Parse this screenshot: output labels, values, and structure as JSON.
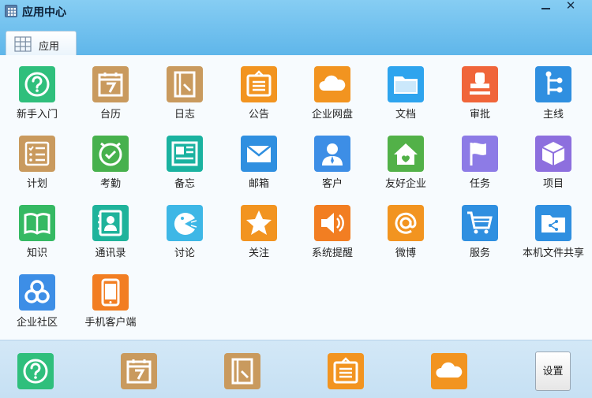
{
  "window": {
    "title": "应用中心",
    "minimize_glyph": "—",
    "close_glyph": "✕"
  },
  "tab": {
    "label": "应用"
  },
  "apps": [
    {
      "label": "新手入门",
      "icon": "help-icon",
      "color": "#2fbf7c"
    },
    {
      "label": "台历",
      "icon": "calendar-icon",
      "color": "#c99a5e"
    },
    {
      "label": "日志",
      "icon": "journal-icon",
      "color": "#c99a5e"
    },
    {
      "label": "公告",
      "icon": "announcement-icon",
      "color": "#f29420"
    },
    {
      "label": "企业网盘",
      "icon": "cloud-drive-icon",
      "color": "#f29420"
    },
    {
      "label": "文档",
      "icon": "folder-icon",
      "color": "#2ea4ee"
    },
    {
      "label": "审批",
      "icon": "stamp-icon",
      "color": "#f0653a"
    },
    {
      "label": "主线",
      "icon": "branch-icon",
      "color": "#2f8fe0"
    },
    {
      "label": "计划",
      "icon": "checklist-icon",
      "color": "#c99a5e"
    },
    {
      "label": "考勤",
      "icon": "clock-icon",
      "color": "#47b14d"
    },
    {
      "label": "备忘",
      "icon": "memo-icon",
      "color": "#1ab2a0"
    },
    {
      "label": "邮箱",
      "icon": "mail-icon",
      "color": "#2f8fe0"
    },
    {
      "label": "客户",
      "icon": "customer-icon",
      "color": "#3d8ee6"
    },
    {
      "label": "友好企业",
      "icon": "friendly-company-icon",
      "color": "#52b148"
    },
    {
      "label": "任务",
      "icon": "flag-icon",
      "color": "#8d7be6"
    },
    {
      "label": "项目",
      "icon": "cube-icon",
      "color": "#8d6fde"
    },
    {
      "label": "知识",
      "icon": "book-icon",
      "color": "#35b963"
    },
    {
      "label": "通讯录",
      "icon": "contacts-icon",
      "color": "#1fb39b"
    },
    {
      "label": "讨论",
      "icon": "discussion-icon",
      "color": "#3eb7e6"
    },
    {
      "label": "关注",
      "icon": "star-icon",
      "color": "#f29420"
    },
    {
      "label": "系统提醒",
      "icon": "speaker-icon",
      "color": "#f27e22"
    },
    {
      "label": "微博",
      "icon": "at-icon",
      "color": "#f29420"
    },
    {
      "label": "服务",
      "icon": "cart-icon",
      "color": "#2f8fe0"
    },
    {
      "label": "本机文件共享",
      "icon": "file-share-icon",
      "color": "#2f8fe0"
    },
    {
      "label": "企业社区",
      "icon": "community-icon",
      "color": "#3d8ee6"
    },
    {
      "label": "手机客户端",
      "icon": "mobile-icon",
      "color": "#f27e22"
    }
  ],
  "dock": [
    {
      "icon": "help-icon",
      "color": "#2fbf7c"
    },
    {
      "icon": "calendar-icon",
      "color": "#c99a5e"
    },
    {
      "icon": "journal-icon",
      "color": "#c99a5e"
    },
    {
      "icon": "announcement-icon",
      "color": "#f29420"
    },
    {
      "icon": "cloud-drive-icon",
      "color": "#f29420"
    }
  ],
  "settings_label": "设置"
}
